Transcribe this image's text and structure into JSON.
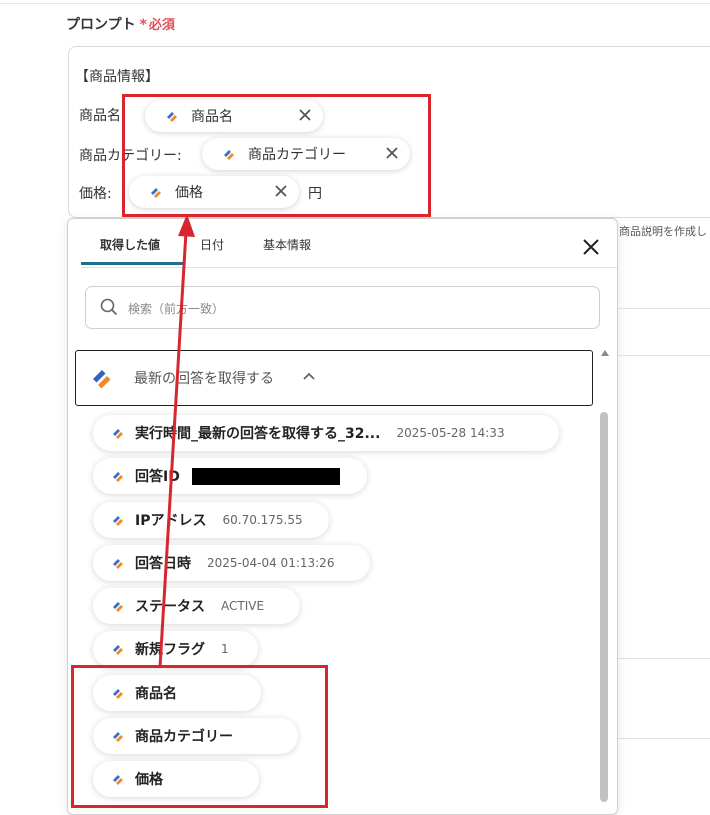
{
  "form": {
    "prompt_label": "プロンプト",
    "required_star": "*",
    "required_text": "必須",
    "lines": {
      "header": "【商品情報】",
      "name_label": "商品名:",
      "category_label": "商品カテゴリー:",
      "price_label": "価格:",
      "price_unit": "円"
    },
    "chips": {
      "name": "商品名",
      "category": "商品カテゴリー",
      "price": "価格"
    },
    "hint_text": "商品説明を作成し"
  },
  "panel": {
    "tabs": [
      "取得した値",
      "日付",
      "基本情報"
    ],
    "active_tab": "取得した値",
    "search_placeholder": "検索（前方一致）",
    "section_title": "最新の回答を取得する",
    "items": [
      {
        "label": "実行時間_最新の回答を取得する_32...",
        "value": "2025-05-28 14:33"
      },
      {
        "label": "回答ID",
        "value": ""
      },
      {
        "label": "IPアドレス",
        "value": "60.70.175.55"
      },
      {
        "label": "回答日時",
        "value": "2025-04-04 01:13:26"
      },
      {
        "label": "ステータス",
        "value": "ACTIVE"
      },
      {
        "label": "新規フラグ",
        "value": "1"
      },
      {
        "label": "商品名",
        "value": ""
      },
      {
        "label": "商品カテゴリー",
        "value": ""
      },
      {
        "label": "価格",
        "value": ""
      }
    ]
  },
  "colors": {
    "accent_red": "#d8262f",
    "required": "#e0505a",
    "tab_underline": "#1f6f8b"
  }
}
